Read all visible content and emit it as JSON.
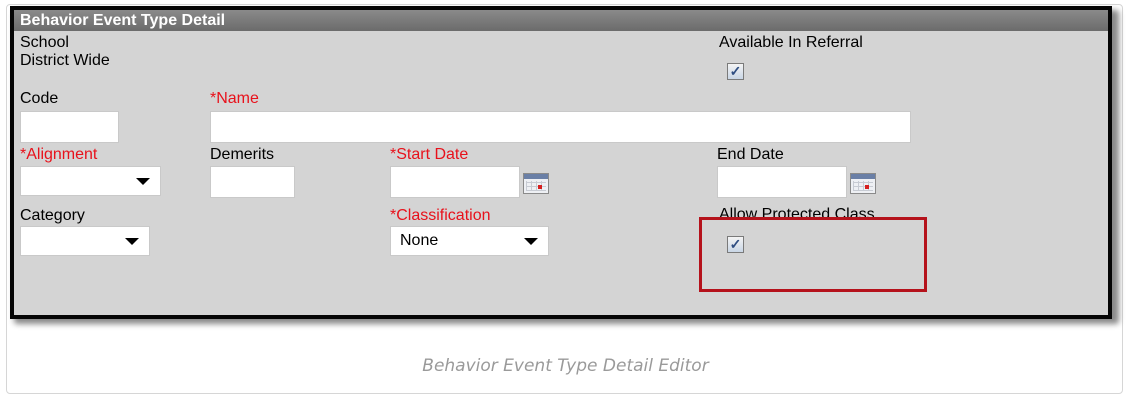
{
  "panel": {
    "title": "Behavior Event Type Detail",
    "school_label": "School",
    "district_wide_label": "District Wide",
    "available_in_referral_label": "Available In Referral",
    "available_in_referral_checked": true,
    "code_label": "Code",
    "code_value": "",
    "name_label": "*Name",
    "name_value": "",
    "alignment_label": "*Alignment",
    "alignment_value": "",
    "demerits_label": "Demerits",
    "demerits_value": "",
    "start_date_label": "*Start Date",
    "start_date_value": "",
    "end_date_label": "End Date",
    "end_date_value": "",
    "category_label": "Category",
    "category_value": "",
    "classification_label": "*Classification",
    "classification_value": "None",
    "allow_protected_class_label": "Allow Protected Class",
    "allow_protected_class_checked": true,
    "check_mark": "✓"
  },
  "caption": "Behavior Event Type Detail Editor",
  "colors": {
    "required_label": "#e8111b",
    "highlight_border": "#b5121b",
    "panel_background": "#d4d4d4",
    "header_background": "#7a7a7a"
  }
}
